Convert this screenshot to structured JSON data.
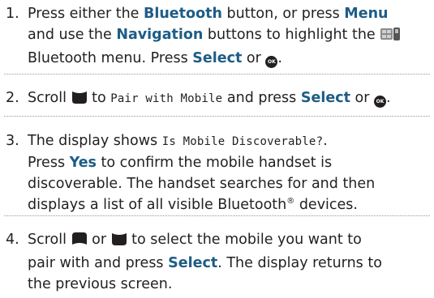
{
  "steps": [
    {
      "number": "1.",
      "l1a": "Press either the ",
      "l1b": "Bluetooth",
      "l1c": " button, or press ",
      "l1d": "Menu",
      "l2a": "and use the ",
      "l2b": "Navigation",
      "l2c": " buttons to highlight the ",
      "l3a": "Bluetooth menu. Press ",
      "l3b": "Select",
      "l3c": " or ",
      "l3d": "."
    },
    {
      "number": "2.",
      "l1a": "Scroll ",
      "l1b": " to ",
      "l1c": "Pair with Mobile",
      "l1d": " and press ",
      "l1e": "Select",
      "l1f": " or ",
      "l1g": "."
    },
    {
      "number": "3.",
      "l1a": "The display shows ",
      "l1b": "Is Mobile Discoverable?",
      "l1c": ".",
      "l2a": "Press ",
      "l2b": "Yes",
      "l2c": " to confirm the mobile handset is",
      "l3": "discoverable. The handset searches for and then",
      "l4a": "displays a list of all visible Bluetooth",
      "l4b": "®",
      "l4c": " devices."
    },
    {
      "number": "4.",
      "l1a": "Scroll ",
      "l1b": " or ",
      "l1c": " to select the mobile you want to",
      "l2a": "pair with and press ",
      "l2b": "Select",
      "l2c": ". The display returns to",
      "l3": "the previous screen."
    }
  ],
  "ok_button_label": "OK",
  "keyword_color": "#1d5d86",
  "icons": [
    "menu-grid-icon",
    "ok-button-icon",
    "scroll-down-icon",
    "scroll-up-icon"
  ]
}
